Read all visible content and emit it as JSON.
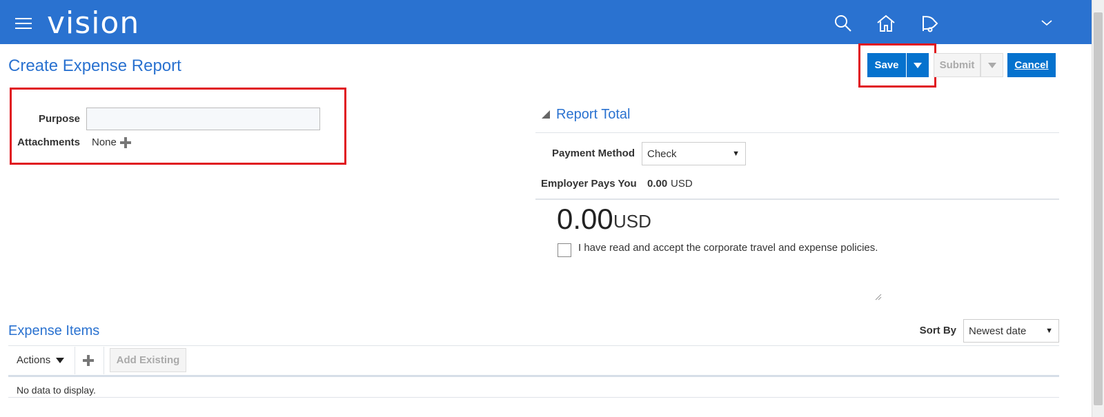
{
  "header": {
    "logo": "vision",
    "icons": [
      "search-icon",
      "home-icon",
      "notifications-icon",
      "user-menu-chevron-icon"
    ]
  },
  "page": {
    "title": "Create Expense Report"
  },
  "toolbar": {
    "save_label": "Save",
    "submit_label": "Submit",
    "cancel_label": "Cancel"
  },
  "form": {
    "purpose_label": "Purpose",
    "purpose_value": "",
    "attachments_label": "Attachments",
    "attachments_value": "None"
  },
  "report_total": {
    "title": "Report Total",
    "payment_method_label": "Payment Method",
    "payment_method_value": "Check",
    "employer_pays_label": "Employer Pays You",
    "employer_pays_amount": "0.00",
    "employer_pays_currency": "USD",
    "total_amount": "0.00",
    "total_currency": "USD",
    "policy_text": "I have read and accept the corporate travel and expense policies.",
    "policy_checked": false
  },
  "expense_items": {
    "title": "Expense Items",
    "sort_by_label": "Sort By",
    "sort_by_value": "Newest date",
    "actions_label": "Actions",
    "add_existing_label": "Add Existing",
    "empty_text": "No data to display."
  },
  "colors": {
    "brand": "#2a72d0",
    "button": "#0572ce",
    "highlight": "#e0141e"
  }
}
